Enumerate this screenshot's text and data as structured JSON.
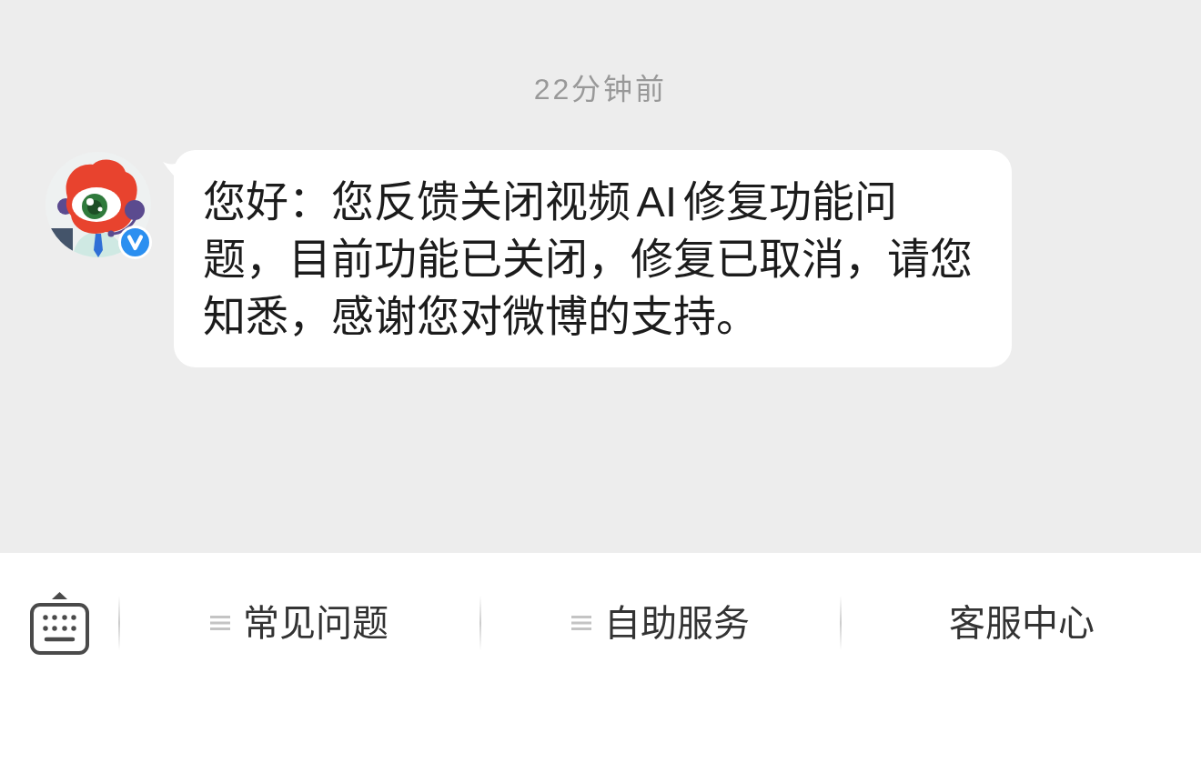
{
  "timestamp": "22分钟前",
  "messages": [
    {
      "verified": true,
      "text": "您好：您反馈关闭视频AI修复功能问题，目前功能已关闭，修复已取消，请您知悉，感谢您对微博的支持。"
    }
  ],
  "bottom_bar": {
    "menus": [
      {
        "kind": "menu",
        "label": "常见问题"
      },
      {
        "kind": "menu",
        "label": "自助服务"
      },
      {
        "kind": "link",
        "label": "客服中心"
      }
    ]
  }
}
